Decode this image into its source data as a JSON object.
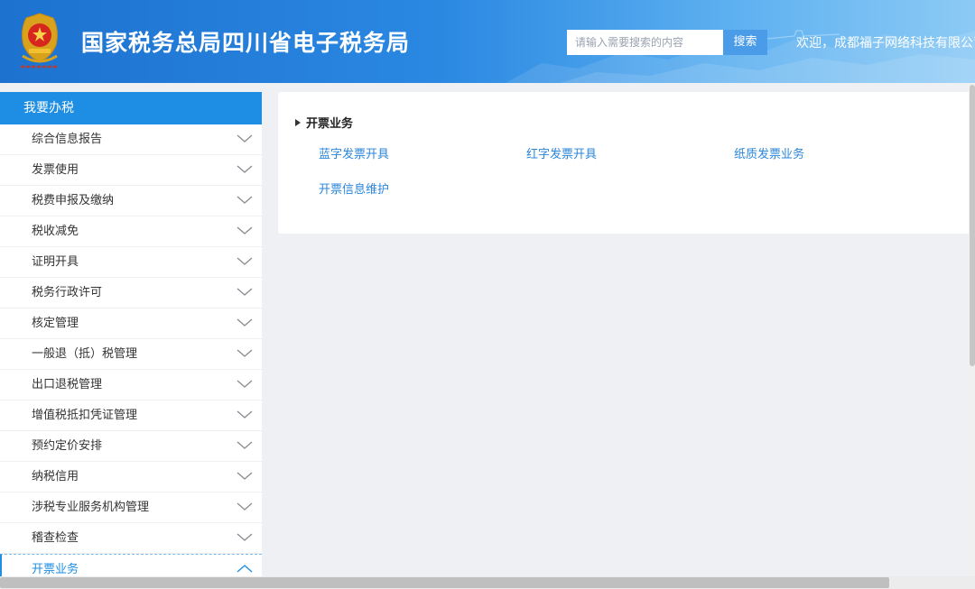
{
  "header": {
    "title": "国家税务总局四川省电子税务局",
    "emblem_caption": "中国税务",
    "search_placeholder": "请输入需要搜索的内容",
    "search_button": "搜索",
    "welcome": "欢迎，成都福子网络科技有限公司"
  },
  "sidebar": {
    "header": "我要办税",
    "items": [
      {
        "label": "综合信息报告",
        "state": "collapsed"
      },
      {
        "label": "发票使用",
        "state": "collapsed"
      },
      {
        "label": "税费申报及缴纳",
        "state": "collapsed"
      },
      {
        "label": "税收减免",
        "state": "collapsed"
      },
      {
        "label": "证明开具",
        "state": "collapsed"
      },
      {
        "label": "税务行政许可",
        "state": "collapsed"
      },
      {
        "label": "核定管理",
        "state": "collapsed"
      },
      {
        "label": "一般退（抵）税管理",
        "state": "collapsed"
      },
      {
        "label": "出口退税管理",
        "state": "collapsed"
      },
      {
        "label": "增值税抵扣凭证管理",
        "state": "collapsed"
      },
      {
        "label": "预约定价安排",
        "state": "collapsed"
      },
      {
        "label": "纳税信用",
        "state": "collapsed"
      },
      {
        "label": "涉税专业服务机构管理",
        "state": "collapsed"
      },
      {
        "label": "稽查检查",
        "state": "collapsed"
      },
      {
        "label": "开票业务",
        "state": "expanded"
      }
    ]
  },
  "main": {
    "section_title": "开票业务",
    "links": [
      "蓝字发票开具",
      "红字发票开具",
      "纸质发票业务",
      "开票信息维护"
    ]
  },
  "colors": {
    "header_blue": "#1d72cf",
    "accent": "#1d8ee4",
    "link": "#2b86d9",
    "page_bg": "#eef0f3"
  }
}
